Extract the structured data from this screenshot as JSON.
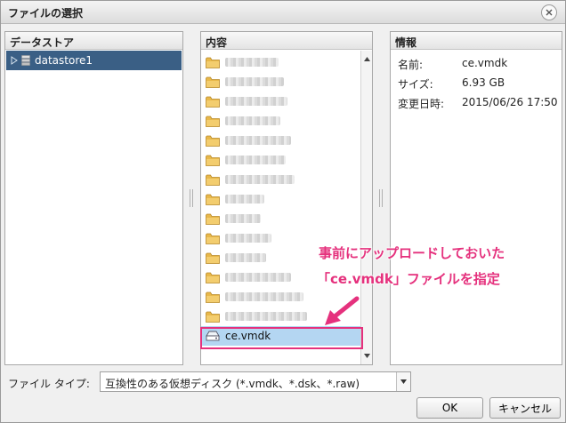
{
  "window": {
    "title": "ファイルの選択"
  },
  "datastore_panel": {
    "header": "データストア",
    "items": [
      {
        "label": "datastore1"
      }
    ]
  },
  "content_panel": {
    "header": "内容",
    "items": [
      {
        "type": "folder",
        "blurred": true
      },
      {
        "type": "folder",
        "blurred": true
      },
      {
        "type": "folder",
        "blurred": true
      },
      {
        "type": "folder",
        "blurred": true
      },
      {
        "type": "folder",
        "blurred": true
      },
      {
        "type": "folder",
        "blurred": true
      },
      {
        "type": "folder",
        "blurred": true
      },
      {
        "type": "folder",
        "blurred": true
      },
      {
        "type": "folder",
        "blurred": true
      },
      {
        "type": "folder",
        "blurred": true
      },
      {
        "type": "folder",
        "blurred": true
      },
      {
        "type": "folder",
        "blurred": true
      },
      {
        "type": "folder",
        "blurred": true
      },
      {
        "type": "folder",
        "blurred": true
      },
      {
        "type": "disk",
        "label": "ce.vmdk",
        "selected": true
      }
    ]
  },
  "info_panel": {
    "header": "情報",
    "rows": [
      {
        "key": "名前:",
        "value": "ce.vmdk"
      },
      {
        "key": "サイズ:",
        "value": "6.93 GB"
      },
      {
        "key": "変更日時:",
        "value": "2015/06/26 17:50"
      }
    ]
  },
  "annotation": {
    "line1": "事前にアップロードしておいた",
    "line2": "「ce.vmdk」ファイルを指定",
    "color": "#e5317d"
  },
  "footer": {
    "file_type_label": "ファイル タイプ:",
    "file_type_value": "互換性のある仮想ディスク (*.vmdk、*.dsk、*.raw)",
    "ok_label": "OK",
    "cancel_label": "キャンセル"
  },
  "colors": {
    "selection_dark": "#3a5f85",
    "selection_light": "#b4d6f2",
    "folder": "#e8b84a"
  }
}
